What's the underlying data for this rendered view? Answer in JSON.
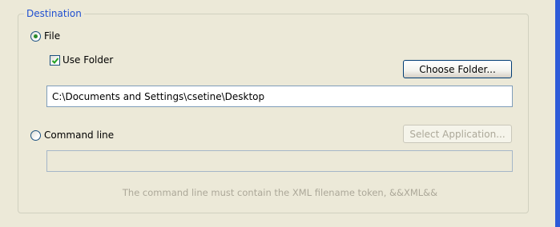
{
  "destination": {
    "legend": "Destination",
    "file_radio": {
      "label": "File",
      "selected": true
    },
    "use_folder": {
      "label": "Use Folder",
      "checked": true
    },
    "choose_folder_label": "Choose Folder...",
    "path_value": "C:\\Documents and Settings\\csetine\\Desktop",
    "command_line_radio": {
      "label": "Command line",
      "selected": false
    },
    "select_application_label": "Select Application...",
    "command_value": "",
    "hint": "The command line must contain the XML filename token, &&XML&&"
  },
  "colors": {
    "legend": "#1f4fd0",
    "accent_edge": "#2e5bd8",
    "disabled_text": "#aca899"
  }
}
